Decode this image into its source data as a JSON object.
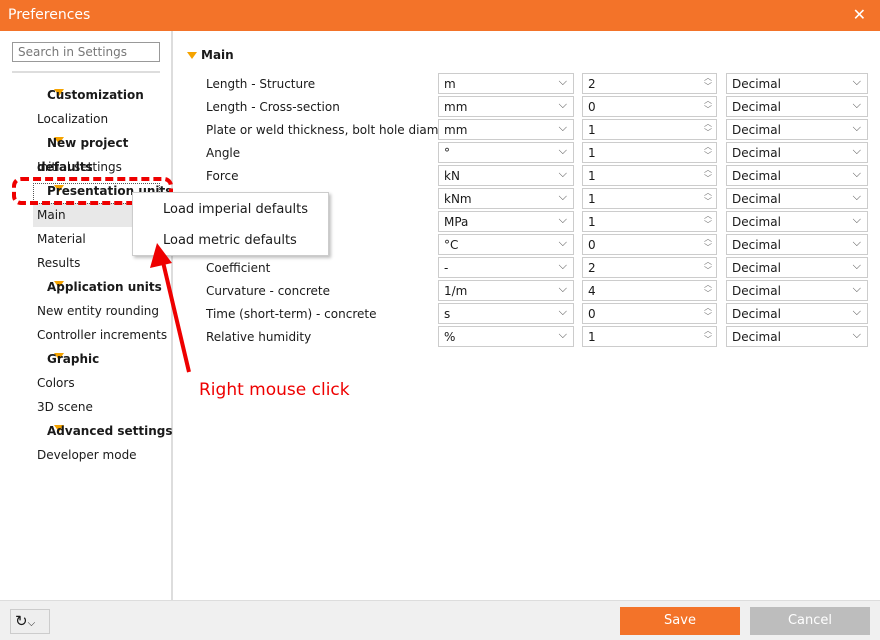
{
  "window": {
    "title": "Preferences",
    "close_icon": "close-icon"
  },
  "sidebar": {
    "search_placeholder": "Search in Settings",
    "items": [
      {
        "label": "Customization",
        "type": "header"
      },
      {
        "label": "Localization",
        "type": "item"
      },
      {
        "label": "New project defaults",
        "type": "header"
      },
      {
        "label": "Initial settings",
        "type": "item"
      },
      {
        "label": "Presentation units",
        "type": "header"
      },
      {
        "label": "Main",
        "type": "item",
        "selected": true
      },
      {
        "label": "Material",
        "type": "item"
      },
      {
        "label": "Results",
        "type": "item"
      },
      {
        "label": "Application units",
        "type": "header"
      },
      {
        "label": "New entity rounding",
        "type": "item"
      },
      {
        "label": "Controller increments",
        "type": "item"
      },
      {
        "label": "Graphic",
        "type": "header"
      },
      {
        "label": "Colors",
        "type": "item"
      },
      {
        "label": "3D scene",
        "type": "item"
      },
      {
        "label": "Advanced settings",
        "type": "header"
      },
      {
        "label": "Developer mode",
        "type": "item"
      }
    ]
  },
  "main": {
    "section": "Main",
    "rows": [
      {
        "label": "Length - Structure",
        "unit": "m",
        "decimals": "2",
        "format": "Decimal"
      },
      {
        "label": "Length - Cross-section",
        "unit": "mm",
        "decimals": "0",
        "format": "Decimal"
      },
      {
        "label": "Plate or weld thickness, bolt hole diameter",
        "unit": "mm",
        "decimals": "1",
        "format": "Decimal"
      },
      {
        "label": "Angle",
        "unit": "°",
        "decimals": "1",
        "format": "Decimal"
      },
      {
        "label": "Force",
        "unit": "kN",
        "decimals": "1",
        "format": "Decimal"
      },
      {
        "label": "",
        "unit": "kNm",
        "decimals": "1",
        "format": "Decimal"
      },
      {
        "label": "",
        "unit": "MPa",
        "decimals": "1",
        "format": "Decimal"
      },
      {
        "label": "",
        "unit": "°C",
        "decimals": "0",
        "format": "Decimal"
      },
      {
        "label": "Coefficient",
        "unit": "-",
        "decimals": "2",
        "format": "Decimal"
      },
      {
        "label": "Curvature - concrete",
        "unit": "1/m",
        "decimals": "4",
        "format": "Decimal"
      },
      {
        "label": "Time (short-term) - concrete",
        "unit": "s",
        "decimals": "0",
        "format": "Decimal"
      },
      {
        "label": "Relative humidity",
        "unit": "%",
        "decimals": "1",
        "format": "Decimal"
      }
    ]
  },
  "context_menu": {
    "items": [
      "Load imperial defaults",
      "Load metric defaults"
    ]
  },
  "annotation": {
    "text": "Right mouse click",
    "color": "#e00000"
  },
  "footer": {
    "save": "Save",
    "cancel": "Cancel",
    "reset_icon": "reset-icon"
  },
  "colors": {
    "accent": "#f37329",
    "tree_arrow": "#f5a300"
  }
}
